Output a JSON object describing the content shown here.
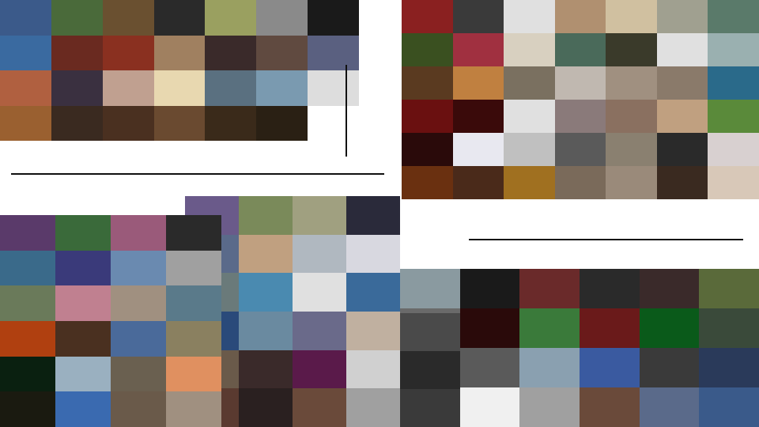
{
  "canvas": {
    "background": "#ffffff"
  },
  "collages": {
    "people_events": {
      "colors": [
        "#3b5a8a",
        "#4a6a3a",
        "#6a5030",
        "#2a2a2a",
        "#9aa060",
        "#8a8a8a",
        "#1a1a1a",
        "#3a6aa0",
        "#6a2a20",
        "#8a3020",
        "#a08060",
        "#3a2a2a",
        "#604a40",
        "#5a6080",
        "#b06040",
        "#3a3040",
        "#c0a090",
        "#e8d8b0",
        "#5a7080",
        "#7a9ab0",
        "#dddddd",
        "#9a6030",
        "#3a2a20",
        "#4a3020",
        "#6a4a30",
        "#3a2a1a",
        "#2a2014",
        "#ffffff"
      ]
    },
    "pets_flowers": {
      "colors": [
        "#8a2020",
        "#3a3a3a",
        "#e0e0e0",
        "#b09070",
        "#d0c0a0",
        "#a0a090",
        "#5a7a6a",
        "#3a5020",
        "#a03040",
        "#d8d0c0",
        "#4a6a5a",
        "#3a3a2a",
        "#e0e0e0",
        "#9ab0b0",
        "#5a3a20",
        "#c08040",
        "#7a7060",
        "#c0b8b0",
        "#a09080",
        "#8a7a6a",
        "#2a6a8a",
        "#6a1010",
        "#3a0a0a",
        "#e0e0e0",
        "#8a7a7a",
        "#8a7060",
        "#c0a080",
        "#5a8a3a",
        "#2a0a0a",
        "#e8e8f0",
        "#c0c0c0",
        "#5a5a5a",
        "#8a8070",
        "#2a2a2a",
        "#d8d0d0",
        "#6a3010",
        "#4a2a1a",
        "#a07020",
        "#7a6a5a",
        "#9a8a7a",
        "#3a2a20",
        "#d8c8b8"
      ]
    },
    "nature_right": {
      "colors": [
        "#6a5a8a",
        "#7a8a5a",
        "#a0a080",
        "#2a2a3a",
        "#5a6a8a",
        "#c0a080",
        "#b0b8c0",
        "#d8d8e0",
        "#6a7a7a",
        "#4a8ab0",
        "#e0e0e0",
        "#3a6a9a",
        "#2a4a7a",
        "#6a8aa0",
        "#6a6a8a",
        "#c0b0a0",
        "#6a5a4a",
        "#3a2a2a",
        "#5a1a4a",
        "#d0d0d0",
        "#5a3a30",
        "#2a2020",
        "#6a4a3a",
        "#a0a0a0"
      ]
    },
    "nature_left": {
      "colors": [
        "#5a3a6a",
        "#3a6a3a",
        "#9a5a7a",
        "#2a2a2a",
        "#3a6a8a",
        "#3a3a7a",
        "#6a8ab0",
        "#a0a0a0",
        "#6a7a5a",
        "#c08090",
        "#a09080",
        "#5a7a8a",
        "#b04010",
        "#4a3020",
        "#4a6a9a",
        "#8a8060",
        "#0a2010",
        "#9ab0c0",
        "#6a6050",
        "#e09060",
        "#1a1a10",
        "#3a6ab0",
        "#6a5a4a",
        "#a09080"
      ]
    },
    "cars": {
      "colors": [
        "#8a9aa0",
        "#1a1a1a",
        "#6a2a2a",
        "#2a2a2a",
        "#3a2a2a",
        "#5a6a3a",
        "#6a6a6a",
        "#2a0a0a",
        "#3a7a3a",
        "#6a1a1a",
        "#0a5a1a",
        "#3a4a3a",
        "#d8d8d8",
        "#5a5a5a",
        "#8aa0b0",
        "#3a5aa0",
        "#3a3a3a",
        "#2a3a5a",
        "#3a3a3a",
        "#f0f0f0",
        "#a0a0a0",
        "#6a4a3a",
        "#5a6a8a",
        "#3a5a8a"
      ]
    },
    "cars_lead": {
      "colors": [
        "#4a4a4a",
        "#2a2a2a",
        "#3a3a3a"
      ]
    }
  },
  "rules": {
    "color": "#111111"
  }
}
